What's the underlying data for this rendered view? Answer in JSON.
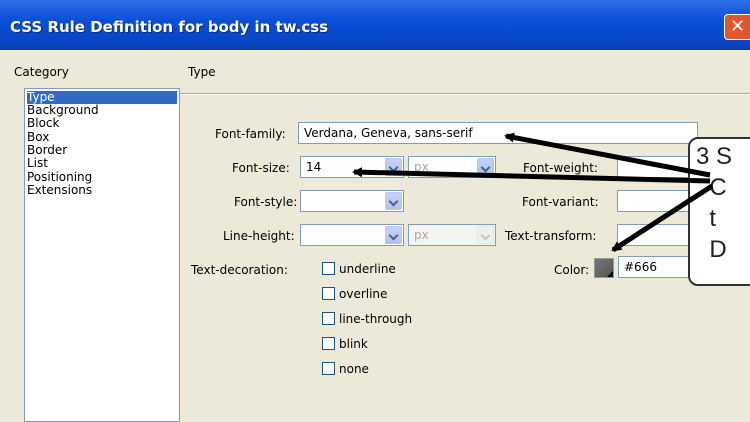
{
  "window": {
    "title": "CSS Rule Definition for body in tw.css",
    "close_glyph": "✕"
  },
  "category": {
    "label": "Category",
    "items": [
      "Type",
      "Background",
      "Block",
      "Box",
      "Border",
      "List",
      "Positioning",
      "Extensions"
    ],
    "selected": "Type"
  },
  "panel": {
    "title": "Type"
  },
  "form": {
    "font_family": {
      "label": "Font-family:",
      "value": "Verdana, Geneva, sans-serif"
    },
    "font_size": {
      "label": "Font-size:",
      "value": "14",
      "unit": "px"
    },
    "font_weight": {
      "label": "Font-weight:",
      "value": ""
    },
    "font_style": {
      "label": "Font-style:",
      "value": ""
    },
    "font_variant": {
      "label": "Font-variant:",
      "value": ""
    },
    "line_height": {
      "label": "Line-height:",
      "value": "",
      "unit": "px"
    },
    "text_transform": {
      "label": "Text-transform:",
      "value": ""
    },
    "color": {
      "label": "Color:",
      "value": "#666",
      "swatch": "#666666"
    },
    "text_decoration": {
      "label": "Text-decoration:",
      "options": [
        "underline",
        "overline",
        "line-through",
        "blink",
        "none"
      ]
    }
  },
  "callout": {
    "text": "3 S\n  C\n  t\n  D"
  },
  "colors": {
    "titlebar": "#0a4fd6",
    "selection": "#316ac5",
    "arrow": "#000000"
  }
}
